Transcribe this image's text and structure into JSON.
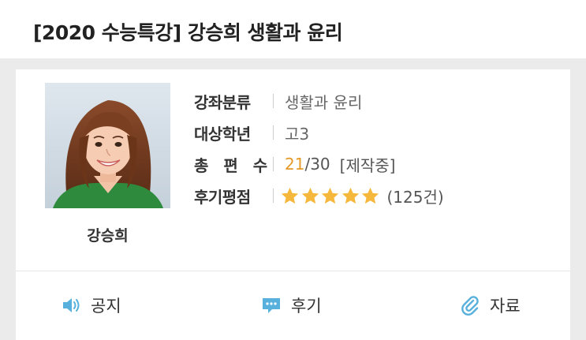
{
  "header": {
    "title": "[2020 수능특강] 강승희 생활과 윤리"
  },
  "teacher": {
    "name": "강승희",
    "photo_icon": "teacher-photo"
  },
  "info": {
    "category_label": "강좌분류",
    "category_value": "생활과 윤리",
    "grade_label": "대상학년",
    "grade_value": "고3",
    "total_label": "총 편 수",
    "total_current": "21",
    "total_rest": "/30",
    "total_status": "[제작중]",
    "rating_label": "후기평점",
    "rating_stars": 5,
    "rating_max": 5,
    "review_count": "(125건)"
  },
  "tabs": [
    {
      "label": "공지",
      "icon": "speaker-icon"
    },
    {
      "label": "후기",
      "icon": "comment-icon"
    },
    {
      "label": "자료",
      "icon": "paperclip-icon"
    }
  ],
  "colors": {
    "accent_orange": "#e59a28",
    "star_fill": "#f5b83d",
    "icon_blue": "#58b1dd"
  }
}
